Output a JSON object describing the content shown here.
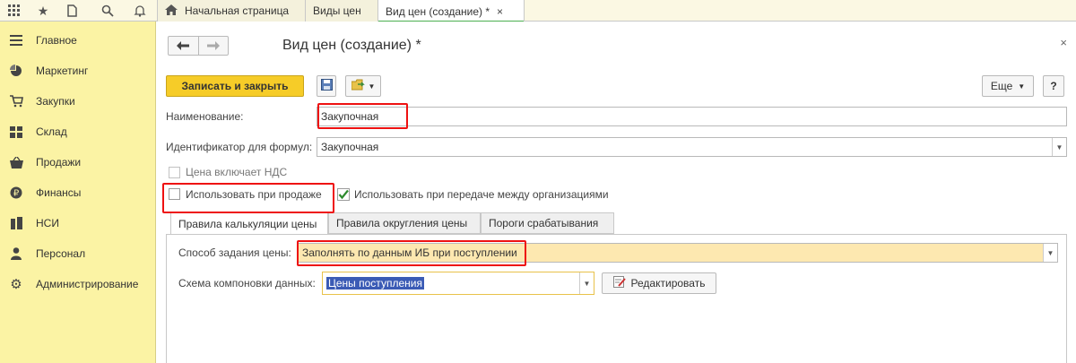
{
  "topbar": {
    "icons": [
      "apps-grid-icon",
      "star-icon",
      "history-icon",
      "search-icon",
      "bell-icon"
    ],
    "tabs": [
      {
        "label": "Начальная страница",
        "icon": "home-icon"
      },
      {
        "label": "Виды цен"
      },
      {
        "label": "Вид цен (создание) *",
        "close": "×"
      }
    ]
  },
  "sidebar": {
    "items": [
      {
        "label": "Главное",
        "icon": "menu-lines-icon"
      },
      {
        "label": "Маркетинг",
        "icon": "pie-chart-icon"
      },
      {
        "label": "Закупки",
        "icon": "cart-icon"
      },
      {
        "label": "Склад",
        "icon": "warehouse-icon"
      },
      {
        "label": "Продажи",
        "icon": "basket-icon"
      },
      {
        "label": "Финансы",
        "icon": "coin-icon"
      },
      {
        "label": "НСИ",
        "icon": "books-icon"
      },
      {
        "label": "Персонал",
        "icon": "person-icon"
      },
      {
        "label": "Администрирование",
        "icon": "gear-icon"
      }
    ]
  },
  "form": {
    "title": "Вид цен (создание) *",
    "close": "×",
    "toolbar": {
      "save_close": "Записать и закрыть",
      "more": "Еще",
      "help": "?"
    },
    "name_label": "Наименование:",
    "name_value": "Закупочная",
    "formula_id_label": "Идентификатор для формул:",
    "formula_id_value": "Закупочная",
    "vat_label": "Цена включает НДС",
    "use_sale_label": "Использовать при продаже",
    "use_transfer_label": "Использовать при передаче между организациями",
    "tabs": [
      "Правила калькуляции цены",
      "Правила округления цены",
      "Пороги срабатывания"
    ],
    "price_method_label": "Способ задания цены:",
    "price_method_value": "Заполнять по данным ИБ при поступлении",
    "schema_label": "Схема компоновки данных:",
    "schema_value": "Цены поступления",
    "edit_label": "Редактировать"
  },
  "colors": {
    "sidebar_bg": "#fbf3a4",
    "primary_button": "#f6cc28",
    "highlight_field": "#fde8b0",
    "annotation_red": "#e11111",
    "selection": "#3b5bb5"
  }
}
